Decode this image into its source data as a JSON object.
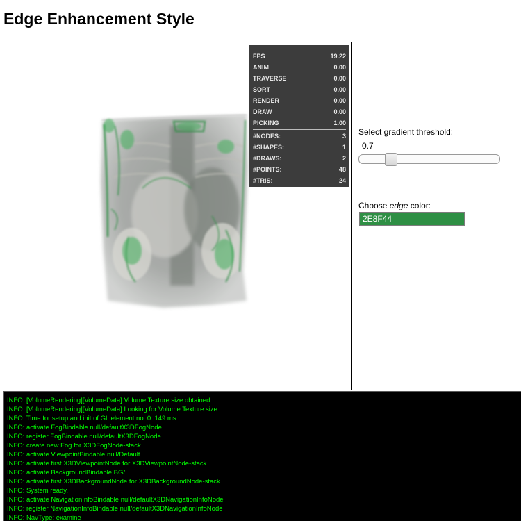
{
  "page": {
    "title": "Edge Enhancement Style"
  },
  "stats": {
    "upper": [
      {
        "label": "FPS",
        "value": "19.22"
      },
      {
        "label": "ANIM",
        "value": "0.00"
      },
      {
        "label": "TRAVERSE",
        "value": "0.00"
      },
      {
        "label": "SORT",
        "value": "0.00"
      },
      {
        "label": "RENDER",
        "value": "0.00"
      },
      {
        "label": "DRAW",
        "value": "0.00"
      },
      {
        "label": "PICKING",
        "value": "1.00"
      }
    ],
    "lower": [
      {
        "label": "#NODES:",
        "value": "3"
      },
      {
        "label": "#SHAPES:",
        "value": "1"
      },
      {
        "label": "#DRAWS:",
        "value": "2"
      },
      {
        "label": "#POINTS:",
        "value": "48"
      },
      {
        "label": "#TRIS:",
        "value": "24"
      }
    ]
  },
  "controls": {
    "threshold_label": "Select gradient threshold:",
    "threshold_value": "0.7",
    "threshold_slider_fraction": 0.2,
    "color_label_prefix": "Choose ",
    "color_label_emph": "edge",
    "color_label_suffix": " color:",
    "color_value": "2E8F44",
    "color_hex": "#2E8F44"
  },
  "log": {
    "lines": [
      "INFO: [VolumeRendering][VolumeData] Volume Texture size obtained",
      "INFO: [VolumeRendering][VolumeData] Looking for Volume Texture size...",
      "INFO: Time for setup and init of GL element no. 0: 149 ms.",
      "INFO: activate FogBindable null/defaultX3DFogNode",
      "INFO: register FogBindable null/defaultX3DFogNode",
      "INFO: create new Fog for X3DFogNode-stack",
      "INFO: activate ViewpointBindable null/Default",
      "INFO: activate first X3DViewpointNode for X3DViewpointNode-stack",
      "INFO: activate BackgroundBindable BG/",
      "INFO: activate first X3DBackgroundNode for X3DBackgroundNode-stack",
      "INFO: System ready.",
      "INFO: activate NavigationInfoBindable null/defaultX3DNavigationInfoNode",
      "INFO: register NavigationInfoBindable null/defaultX3DNavigationInfoNode",
      "INFO: NavType: examine"
    ]
  }
}
